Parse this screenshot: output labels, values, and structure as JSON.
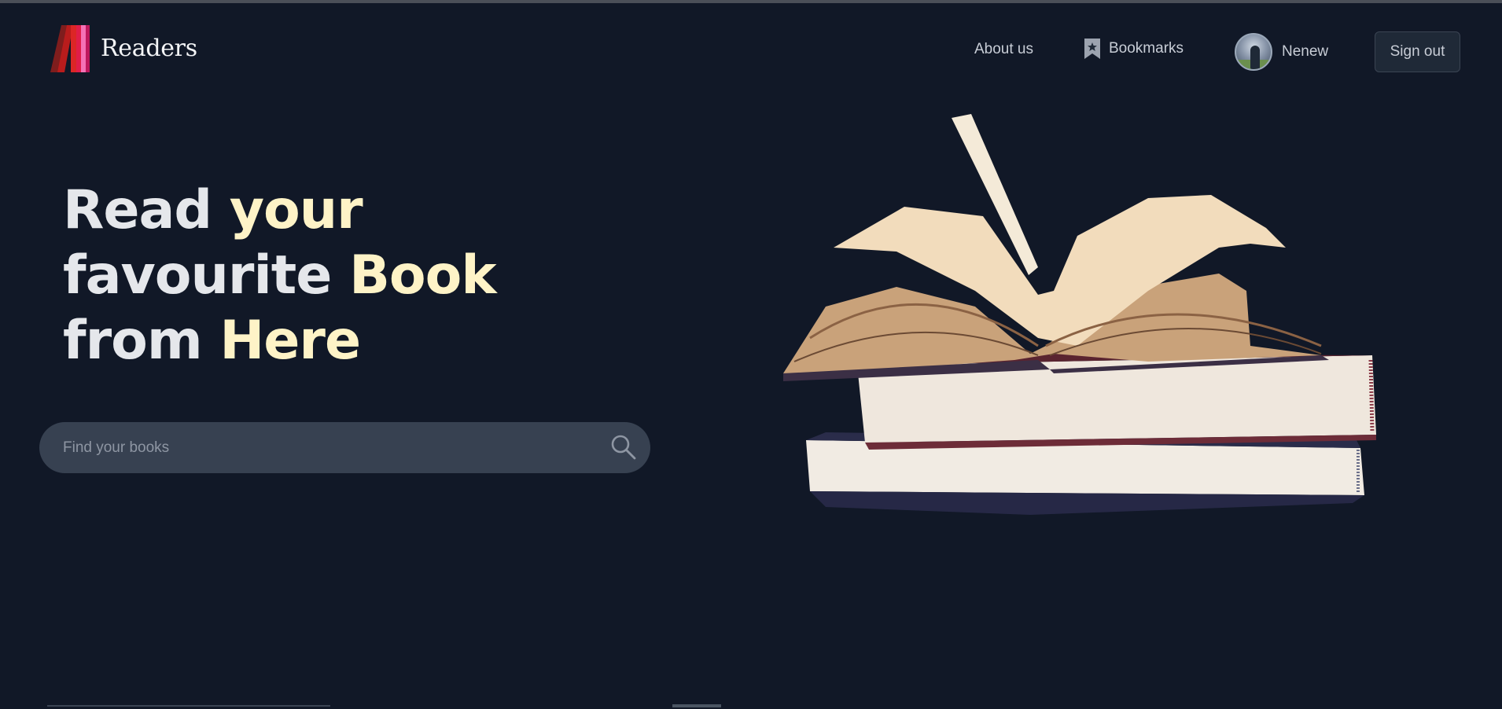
{
  "brand": {
    "name": "Readers",
    "logo_icon": "books-spine-logo"
  },
  "nav": {
    "about_label": "About us",
    "bookmarks_label": "Bookmarks",
    "bookmarks_icon": "bookmark-icon",
    "user_name": "Nenew",
    "signout_label": "Sign out"
  },
  "hero": {
    "line1": {
      "plain": "Read ",
      "highlight": "your"
    },
    "line2": {
      "plain": "favourite ",
      "highlight": "Book"
    },
    "line3": {
      "plain": "from ",
      "highlight": "Here"
    },
    "highlight_color": "#fef3c7"
  },
  "search": {
    "placeholder": "Find your books",
    "value": "",
    "icon": "search-icon"
  },
  "colors": {
    "background": "#111827",
    "search_bg": "#374151",
    "text": "#e5e7eb"
  }
}
